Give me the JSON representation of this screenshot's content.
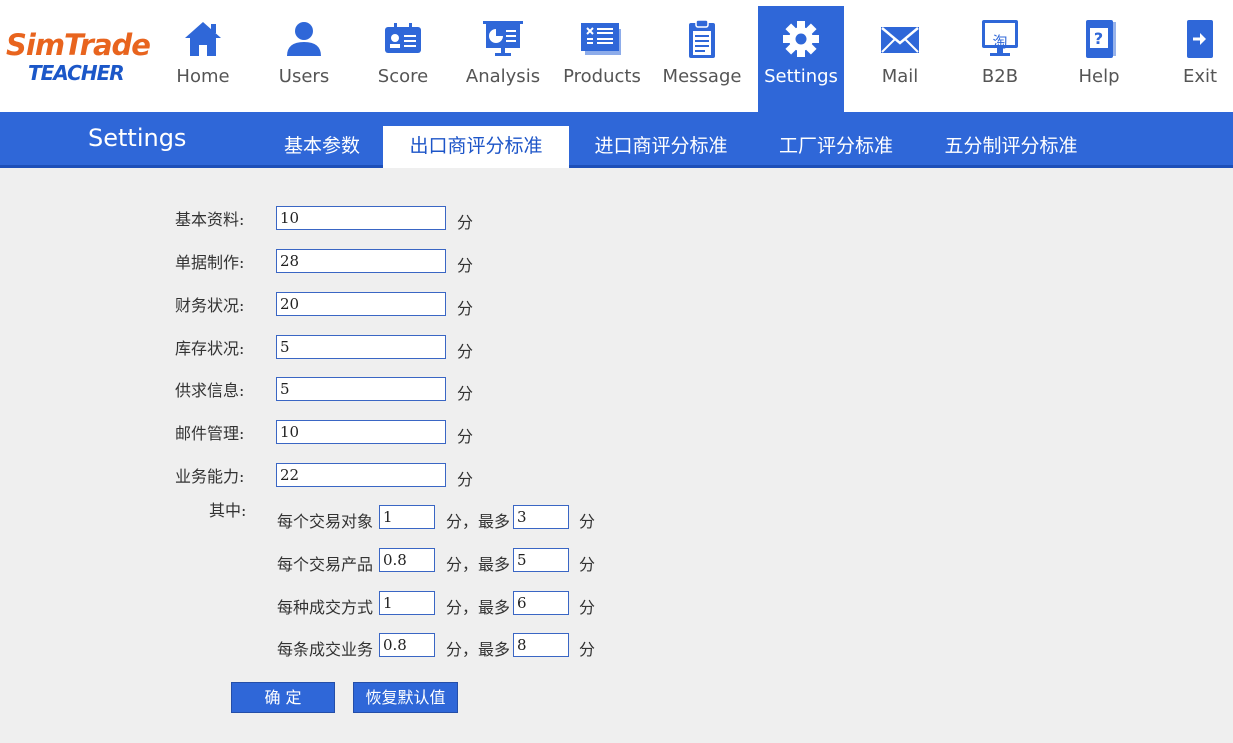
{
  "logo": {
    "line1": "SimTrade",
    "line2": "TEACHER"
  },
  "nav": [
    {
      "label": "Home",
      "icon": "home-icon"
    },
    {
      "label": "Users",
      "icon": "user-icon"
    },
    {
      "label": "Score",
      "icon": "score-card-icon"
    },
    {
      "label": "Analysis",
      "icon": "presentation-chart-icon"
    },
    {
      "label": "Products",
      "icon": "products-icon"
    },
    {
      "label": "Message",
      "icon": "clipboard-icon"
    },
    {
      "label": "Settings",
      "icon": "gear-icon",
      "active": true
    },
    {
      "label": "Mail",
      "icon": "envelope-icon"
    },
    {
      "label": "B2B",
      "icon": "monitor-icon",
      "glyph": "淘"
    },
    {
      "label": "Help",
      "icon": "help-book-icon",
      "glyph": "?"
    },
    {
      "label": "Exit",
      "icon": "exit-icon"
    }
  ],
  "page_title": "Settings",
  "tabs": [
    {
      "label": "基本参数"
    },
    {
      "label": "出口商评分标准",
      "active": true
    },
    {
      "label": "进口商评分标准"
    },
    {
      "label": "工厂评分标准"
    },
    {
      "label": "五分制评分标准"
    }
  ],
  "fields": [
    {
      "label": "基本资料:",
      "value": "10",
      "unit": "分"
    },
    {
      "label": "单据制作:",
      "value": "28",
      "unit": "分"
    },
    {
      "label": "财务状况:",
      "value": "20",
      "unit": "分"
    },
    {
      "label": "库存状况:",
      "value": "5",
      "unit": "分"
    },
    {
      "label": "供求信息:",
      "value": "5",
      "unit": "分"
    },
    {
      "label": "邮件管理:",
      "value": "10",
      "unit": "分"
    },
    {
      "label": "业务能力:",
      "value": "22",
      "unit": "分"
    }
  ],
  "sub_section_label": "其中:",
  "sub_fields": [
    {
      "label": "每个交易对象",
      "value": "1",
      "mid": "分，最多",
      "max": "3",
      "unit": "分"
    },
    {
      "label": "每个交易产品",
      "value": "0.8",
      "mid": "分，最多",
      "max": "5",
      "unit": "分"
    },
    {
      "label": "每种成交方式",
      "value": "1",
      "mid": "分，最多",
      "max": "6",
      "unit": "分"
    },
    {
      "label": "每条成交业务",
      "value": "0.8",
      "mid": "分，最多",
      "max": "8",
      "unit": "分"
    }
  ],
  "buttons": {
    "confirm": "确 定",
    "restore": "恢复默认值"
  },
  "colors": {
    "accent": "#2f67d8",
    "logo_orange": "#e8641e",
    "logo_blue": "#1b57c8",
    "background": "#efefef"
  }
}
